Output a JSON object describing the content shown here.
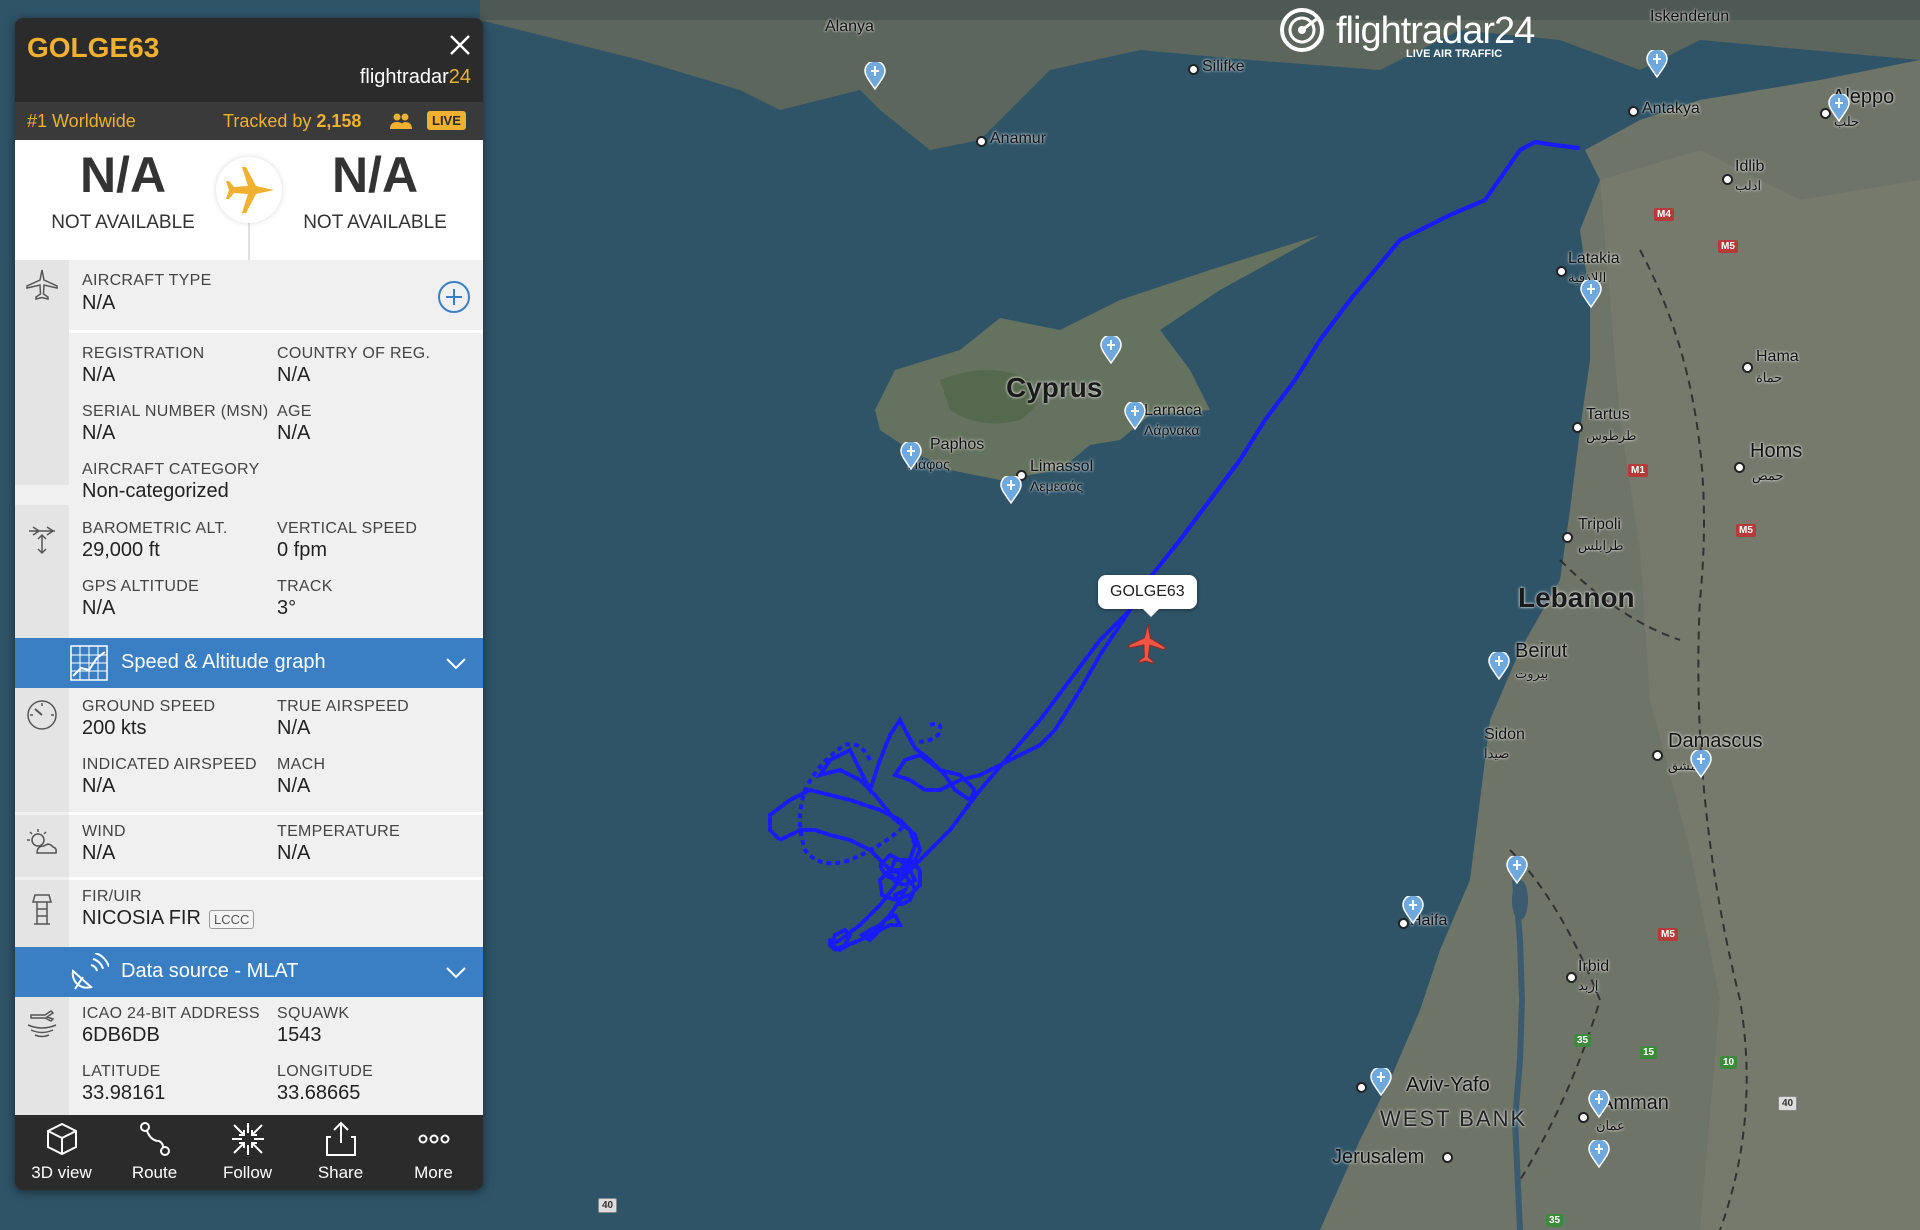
{
  "app": {
    "brand": "flightradar24",
    "brand_sub": "LIVE AIR TRAFFIC"
  },
  "flight": {
    "callsign": "GOLGE63",
    "panel_brand_main": "flightradar",
    "panel_brand_num": "24",
    "rank": "#1 Worldwide",
    "tracked_label": "Tracked by ",
    "tracked_count": "2,158",
    "live_badge": "LIVE",
    "origin_code": "N/A",
    "origin_name": "NOT AVAILABLE",
    "dest_code": "N/A",
    "dest_name": "NOT AVAILABLE"
  },
  "aircraft": {
    "type_label": "AIRCRAFT TYPE",
    "type_value": "N/A",
    "registration_label": "REGISTRATION",
    "registration_value": "N/A",
    "country_label": "COUNTRY OF REG.",
    "country_value": "N/A",
    "serial_label": "SERIAL NUMBER (MSN)",
    "serial_value": "N/A",
    "age_label": "AGE",
    "age_value": "N/A",
    "category_label": "AIRCRAFT CATEGORY",
    "category_value": "Non-categorized"
  },
  "altitude": {
    "baro_label": "BAROMETRIC ALT.",
    "baro_value": "29,000 ft",
    "vs_label": "VERTICAL SPEED",
    "vs_value": "0 fpm",
    "gps_label": "GPS ALTITUDE",
    "gps_value": "N/A",
    "track_label": "TRACK",
    "track_value": "3°"
  },
  "graph_bar": {
    "label": "Speed & Altitude graph"
  },
  "speed": {
    "gs_label": "GROUND SPEED",
    "gs_value": "200 kts",
    "tas_label": "TRUE AIRSPEED",
    "tas_value": "N/A",
    "ias_label": "INDICATED AIRSPEED",
    "ias_value": "N/A",
    "mach_label": "MACH",
    "mach_value": "N/A"
  },
  "weather": {
    "wind_label": "WIND",
    "wind_value": "N/A",
    "temp_label": "TEMPERATURE",
    "temp_value": "N/A"
  },
  "fir": {
    "label": "FIR/UIR",
    "value": "NICOSIA FIR",
    "code": "LCCC"
  },
  "source_bar": {
    "label": "Data source - MLAT"
  },
  "transponder": {
    "icao_label": "ICAO 24-BIT ADDRESS",
    "icao_value": "6DB6DB",
    "squawk_label": "SQUAWK",
    "squawk_value": "1543",
    "lat_label": "LATITUDE",
    "lat_value": "33.98161",
    "lon_label": "LONGITUDE",
    "lon_value": "33.68665"
  },
  "toolbar": [
    {
      "label": "3D view",
      "icon": "cube-icon"
    },
    {
      "label": "Route",
      "icon": "route-icon"
    },
    {
      "label": "Follow",
      "icon": "follow-icon"
    },
    {
      "label": "Share",
      "icon": "share-icon"
    },
    {
      "label": "More",
      "icon": "more-icon"
    }
  ],
  "map": {
    "callout": "GOLGE63",
    "places": {
      "cyprus": "Cyprus",
      "lebanon": "Lebanon",
      "west_bank": "WEST BANK",
      "alanya": "Alanya",
      "anamur": "Anamur",
      "silifke": "Silifke",
      "iskenderun": "Iskenderun",
      "antakya": "Antakya",
      "aleppo": "Aleppo",
      "aleppo_ar": "حلب",
      "idlib": "Idlib",
      "idlib_ar": "ادلب",
      "latakia": "Latakia",
      "latakia_ar": "اللاذقية",
      "hama": "Hama",
      "hama_ar": "حماة",
      "tartus": "Tartus",
      "tartus_ar": "طرطوس",
      "homs": "Homs",
      "homs_ar": "حمص",
      "tripoli": "Tripoli",
      "tripoli_ar": "طرابلس",
      "beirut": "Beirut",
      "beirut_ar": "بيروت",
      "sidon": "Sidon",
      "sidon_ar": "صيدا",
      "damascus": "Damascus",
      "damascus_ar": "دمشق",
      "haifa": "Haifa",
      "irbid": "Irbid",
      "irbid_ar": "إربد",
      "aviv": "Aviv-Yafo",
      "amman": "Amman",
      "amman_ar": "عمان",
      "jerusalem": "Jerusalem",
      "paphos": "Paphos",
      "paphos_gr": "Πάφος",
      "limassol": "Limassol",
      "limassol_gr": "Λεμεσός",
      "larnaca": "Larnaca",
      "larnaca_gr": "Λάρνακα"
    },
    "roads": {
      "m4": "M4",
      "m5a": "M5",
      "m1": "M1",
      "m5b": "M5",
      "m5c": "M5",
      "r35": "35",
      "r15": "15",
      "r10": "10",
      "r40a": "40",
      "r40b": "40",
      "r35b": "35"
    },
    "colors": {
      "sea": "#2f5468",
      "track": "#1a1aff",
      "accent": "#f0b030",
      "bar": "#3a7fc4"
    }
  }
}
